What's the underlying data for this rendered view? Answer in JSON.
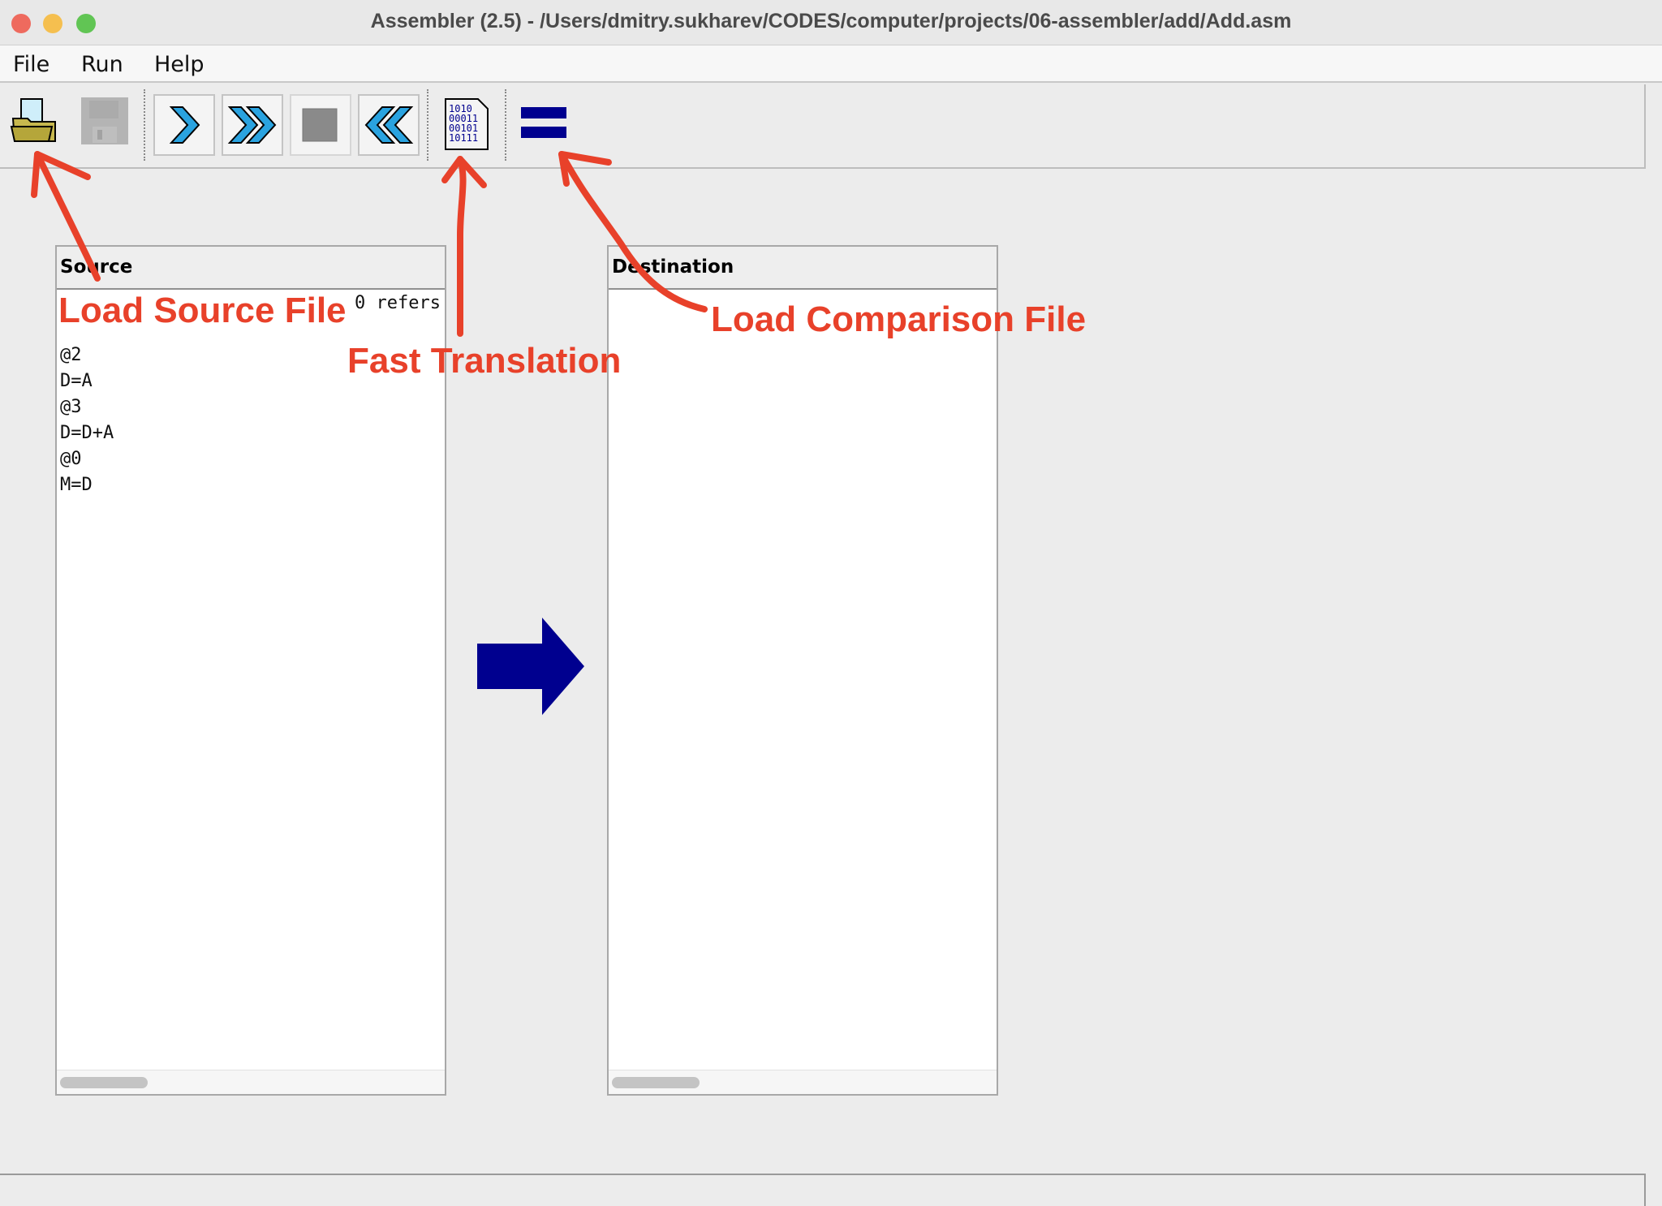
{
  "window": {
    "title": "Assembler (2.5) - /Users/dmitry.sukharev/CODES/computer/projects/06-assembler/add/Add.asm"
  },
  "menu": [
    "File",
    "Run",
    "Help"
  ],
  "toolbar": {
    "translate_icon_text": [
      "1010",
      "00011",
      "00101",
      "10111"
    ]
  },
  "source": {
    "header": "Source",
    "partial_line": "0 refers",
    "lines": [
      "@2",
      "D=A",
      "@3",
      "D=D+A",
      "@0",
      "M=D"
    ]
  },
  "destination": {
    "header": "Destination",
    "lines": []
  },
  "annotations": {
    "load_source": "Load Source File",
    "fast_translation": "Fast Translation",
    "load_comparison": "Load Comparison File"
  },
  "colors": {
    "annotation": "#e8412a",
    "arrow": "#00008f"
  }
}
